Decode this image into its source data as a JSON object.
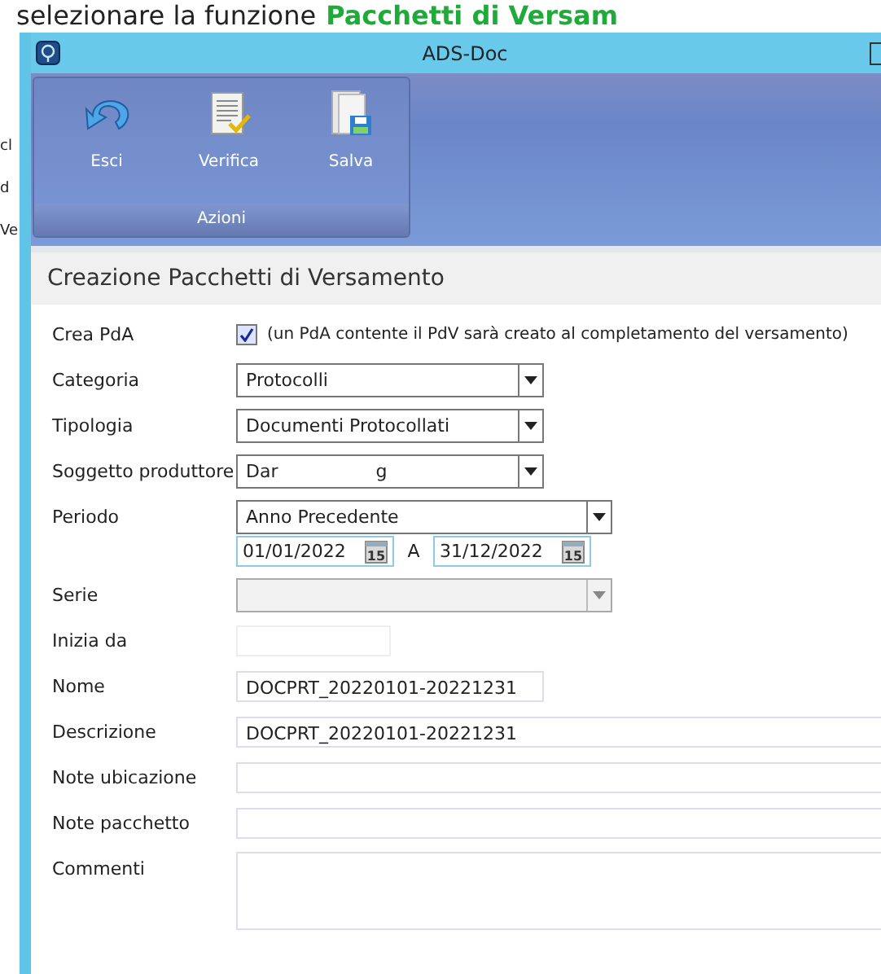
{
  "document": {
    "intro": "selezionare la funzione",
    "highlight": "Pacchetti di Versam",
    "margin_fragments": [
      "cl",
      "d",
      "Ve"
    ]
  },
  "window": {
    "title": "ADS-Doc"
  },
  "ribbon": {
    "group": "Azioni",
    "buttons": [
      {
        "label": "Esci"
      },
      {
        "label": "Verifica"
      },
      {
        "label": "Salva"
      }
    ]
  },
  "panel": {
    "title": "Creazione Pacchetti di Versamento"
  },
  "fields": [
    {
      "kind": "checkbox",
      "label": "Crea PdA",
      "checked": true,
      "text": "(un PdA contente il PdV sarà creato al completamento del versamento)"
    },
    {
      "kind": "combo",
      "label": "Categoria",
      "value": "Protocolli"
    },
    {
      "kind": "combo",
      "label": "Tipologia",
      "value": "Documenti Protocollati"
    },
    {
      "kind": "redacted-combo",
      "label": "Soggetto produttore",
      "value_parts": [
        "Dar",
        "g"
      ]
    },
    {
      "kind": "period",
      "label": "Periodo",
      "value": "Anno Precedente",
      "from": "01/01/2022",
      "separator": "A",
      "to": "31/12/2022",
      "from_calendar_day": "15",
      "to_calendar_day": "15"
    },
    {
      "kind": "combo",
      "label": "Serie",
      "disabled": true
    },
    {
      "kind": "short-text",
      "label": "Inizia da"
    },
    {
      "kind": "text",
      "label": "Nome",
      "value": "DOCPRT_20220101-20221231"
    },
    {
      "kind": "wide-text",
      "label": "Descrizione",
      "value": "DOCPRT_20220101-20221231"
    },
    {
      "kind": "wide-text",
      "label": "Note ubicazione"
    },
    {
      "kind": "wide-text",
      "label": "Note pacchetto"
    },
    {
      "kind": "textarea",
      "label": "Commenti"
    }
  ]
}
